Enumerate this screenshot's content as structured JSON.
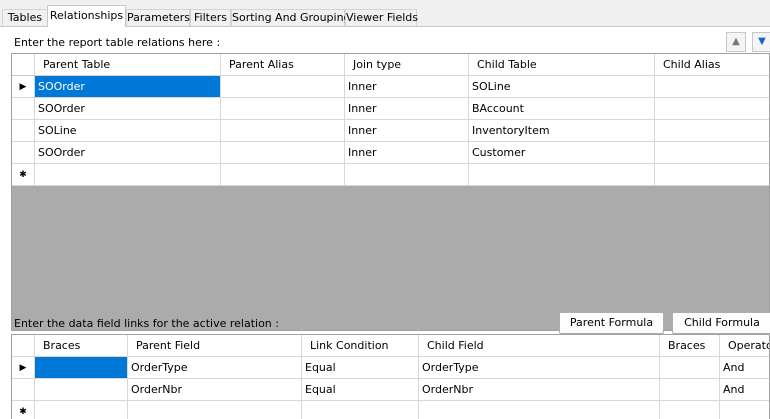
{
  "tabs": [
    {
      "label": "Tables"
    },
    {
      "label": "Relationships"
    },
    {
      "label": "Parameters"
    },
    {
      "label": "Filters"
    },
    {
      "label": "Sorting And Grouping"
    },
    {
      "label": "Viewer Fields"
    }
  ],
  "relations": {
    "prompt": "Enter the report table relations here :",
    "columns": [
      "Parent Table",
      "Parent Alias",
      "Join type",
      "Child Table",
      "Child Alias"
    ],
    "rows": [
      [
        "SOOrder",
        "",
        "Inner",
        "SOLine",
        ""
      ],
      [
        "SOOrder",
        "",
        "Inner",
        "BAccount",
        ""
      ],
      [
        "SOLine",
        "",
        "Inner",
        "InventoryItem",
        ""
      ],
      [
        "SOOrder",
        "",
        "Inner",
        "Customer",
        ""
      ]
    ],
    "current_row_glyph": "▶",
    "new_row_glyph": "✱"
  },
  "links": {
    "prompt": "Enter the data field links for the active relation :",
    "parent_formula_label": "Parent Formula",
    "child_formula_label": "Child Formula",
    "columns": [
      "Braces",
      "Parent Field",
      "Link Condition",
      "Child Field",
      "Braces",
      "Operator"
    ],
    "rows": [
      [
        "",
        "OrderType",
        "Equal",
        "OrderType",
        "",
        "And"
      ],
      [
        "",
        "OrderNbr",
        "Equal",
        "OrderNbr",
        "",
        "And"
      ]
    ],
    "current_row_glyph": "▶",
    "new_row_glyph": "✱"
  },
  "move_up_icon": "arrow-up-icon",
  "move_down_icon": "arrow-down-icon",
  "colors": {
    "selection": "#0078d7",
    "empty_area": "#ababab"
  }
}
